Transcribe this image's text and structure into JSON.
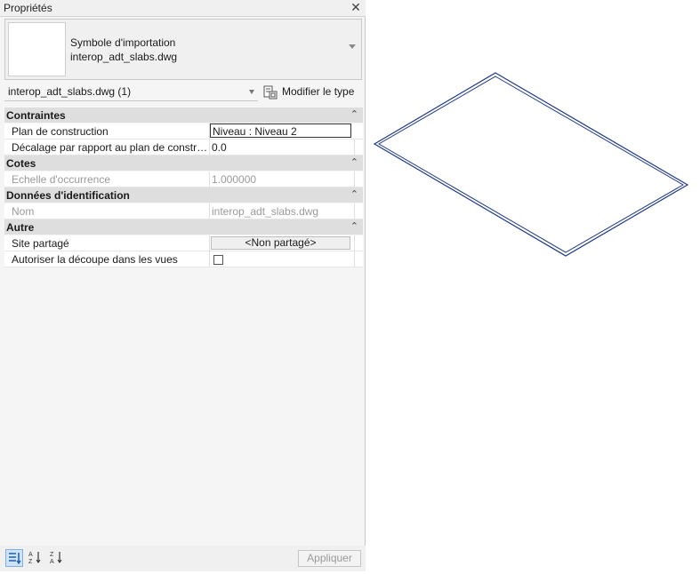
{
  "palette": {
    "title": "Propriétés",
    "close_icon": "close-icon"
  },
  "preview": {
    "family": "Symbole d'importation",
    "type": "interop_adt_slabs.dwg"
  },
  "selector": {
    "value": "interop_adt_slabs.dwg (1)",
    "edit_type_label": "Modifier le type"
  },
  "sections": {
    "contraintes": {
      "label": "Contraintes",
      "rows": [
        {
          "name": "Plan de construction",
          "value": "Niveau : Niveau 2"
        },
        {
          "name": "Décalage par rapport au plan de construction",
          "value": "0.0"
        }
      ]
    },
    "cotes": {
      "label": "Cotes",
      "rows": [
        {
          "name": "Echelle d'occurrence",
          "value": "1.000000"
        }
      ]
    },
    "identification": {
      "label": "Données d'identification",
      "rows": [
        {
          "name": "Nom",
          "value": "interop_adt_slabs.dwg"
        }
      ]
    },
    "autre": {
      "label": "Autre",
      "rows": [
        {
          "name": "Site partagé",
          "value": "<Non partagé>"
        },
        {
          "name": "Autoriser la découpe dans les vues",
          "checked": false
        }
      ]
    }
  },
  "bottom": {
    "apply_label": "Appliquer"
  },
  "colors": {
    "model_edge": "#1f3a8a",
    "category_bg": "#dedede",
    "sort_active": "#cfe3f7"
  }
}
